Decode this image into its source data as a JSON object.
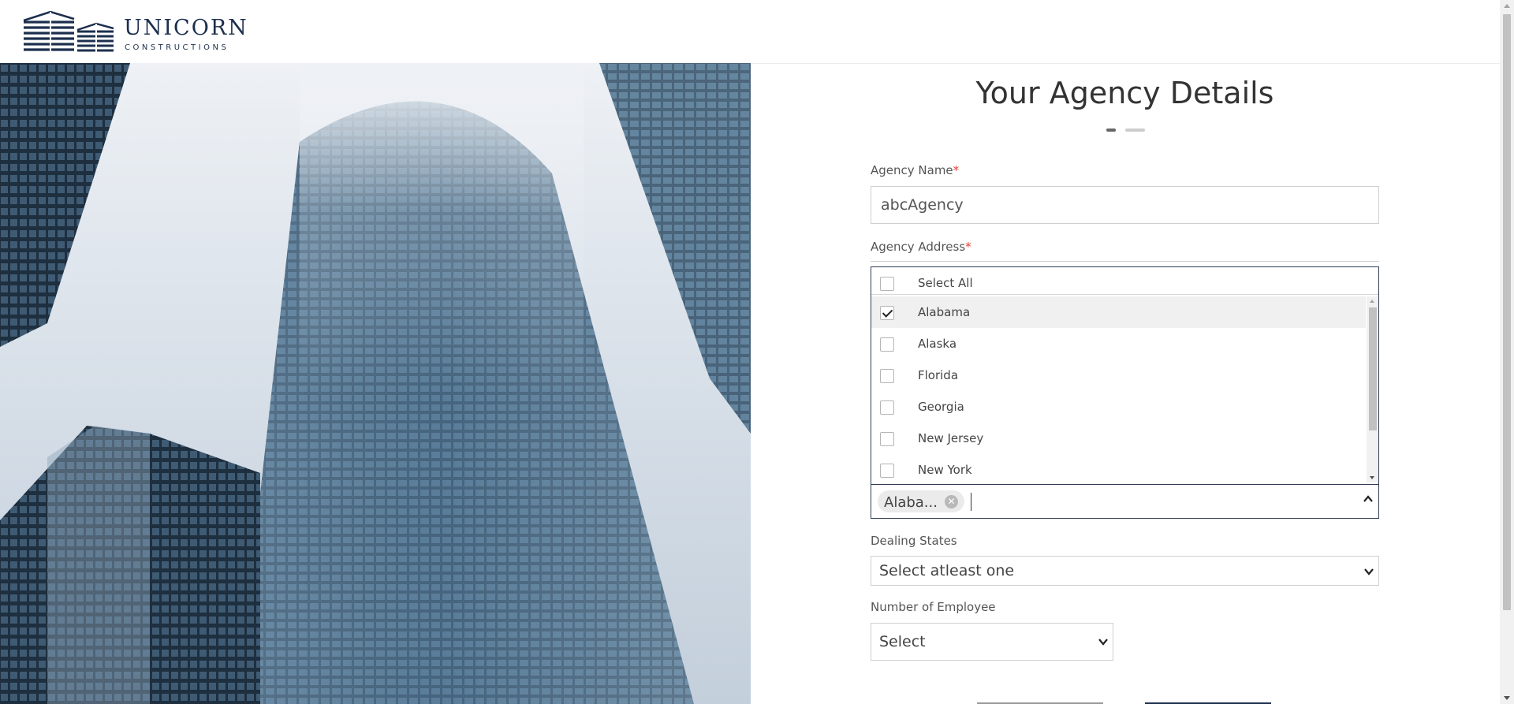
{
  "brand": {
    "name": "UNICORN",
    "tagline": "CONSTRUCTIONS"
  },
  "form": {
    "title": "Your Agency Details",
    "agency_name": {
      "label": "Agency Name",
      "required_mark": "*",
      "value": "abcAgency"
    },
    "agency_address": {
      "label": "Agency Address",
      "required_mark": "*",
      "select_all_label": "Select All",
      "options": [
        {
          "label": "Alabama",
          "checked": true
        },
        {
          "label": "Alaska",
          "checked": false
        },
        {
          "label": "Florida",
          "checked": false
        },
        {
          "label": "Georgia",
          "checked": false
        },
        {
          "label": "New Jersey",
          "checked": false
        },
        {
          "label": "New York",
          "checked": false
        }
      ],
      "selected_chip": "Alaba..."
    },
    "dealing_states": {
      "label": "Dealing States",
      "value": "Select atleast one"
    },
    "num_employees": {
      "label": "Number of Employee",
      "value": "Select"
    }
  },
  "colors": {
    "brand_navy": "#1c2f4d",
    "required": "#e53935",
    "focus_border": "#2f3d55"
  }
}
